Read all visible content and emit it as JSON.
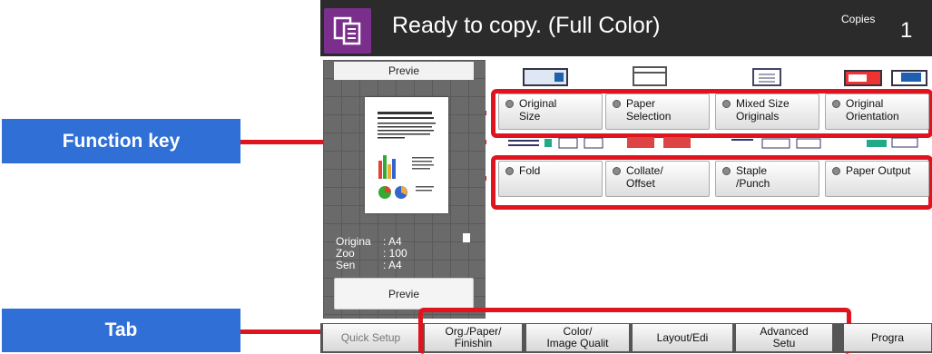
{
  "callouts": {
    "function_key": "Function key",
    "tab": "Tab"
  },
  "header": {
    "title": "Ready to copy. (Full Color)",
    "copies_label": "Copies",
    "copies_value": "1",
    "icon": "copy-icon"
  },
  "preview_panel": {
    "title": "Previe",
    "info": [
      {
        "label": "Origina",
        "value": ": A4"
      },
      {
        "label": "Zoo",
        "value": ": 100"
      },
      {
        "label": "Sen",
        "value": ": A4"
      }
    ],
    "preview_button": "Previe"
  },
  "function_row1": [
    {
      "line1": "Original",
      "line2": "Size"
    },
    {
      "line1": "Paper",
      "line2": "Selection"
    },
    {
      "line1": "Mixed Size",
      "line2": "Originals"
    },
    {
      "line1": "Original",
      "line2": "Orientation"
    }
  ],
  "function_row2": [
    {
      "line1": "Fold",
      "line2": ""
    },
    {
      "line1": "Collate/",
      "line2": "Offset"
    },
    {
      "line1": "Staple",
      "line2": "/Punch"
    },
    {
      "line1": "Paper Output",
      "line2": ""
    }
  ],
  "tabs": [
    {
      "line1": "Quick Setup",
      "line2": ""
    },
    {
      "line1": "Org./Paper/",
      "line2": "Finishin"
    },
    {
      "line1": "Color/",
      "line2": "Image Qualit"
    },
    {
      "line1": "Layout/Edi",
      "line2": ""
    },
    {
      "line1": "Advanced",
      "line2": "Setu"
    },
    {
      "line1": "Progra",
      "line2": ""
    }
  ],
  "colors": {
    "callout_blue": "#2f6fd6",
    "highlight_red": "#e0141e",
    "header_bg": "#2b2b2b",
    "icon_purple": "#7b2f8c"
  }
}
